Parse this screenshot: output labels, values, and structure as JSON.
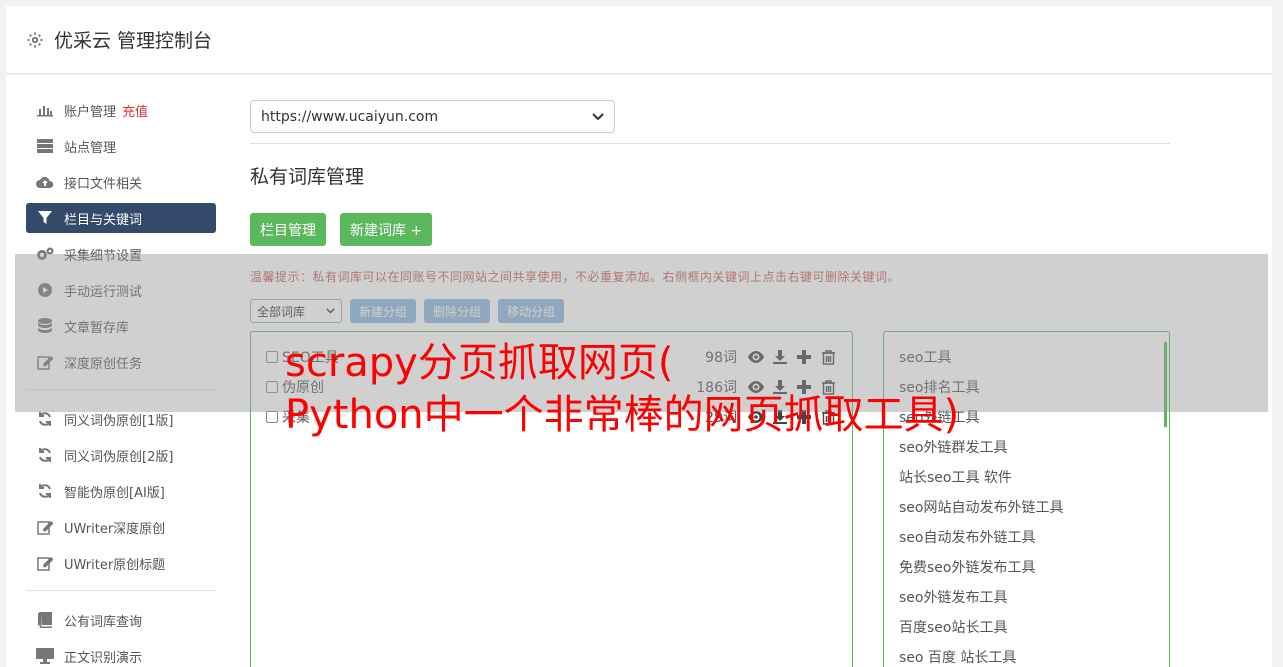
{
  "header": {
    "title": "优采云 管理控制台",
    "icon": "gear-icon"
  },
  "sidebar": {
    "group1": [
      {
        "label": "账户管理",
        "extra": "充值",
        "icon": "bar-chart-icon"
      },
      {
        "label": "站点管理",
        "icon": "server-icon"
      },
      {
        "label": "接口文件相关",
        "icon": "cloud-upload-icon"
      },
      {
        "label": "栏目与关键词",
        "icon": "filter-icon",
        "active": true
      },
      {
        "label": "采集细节设置",
        "icon": "gears-icon"
      },
      {
        "label": "手动运行测试",
        "icon": "play-icon"
      },
      {
        "label": "文章暂存库",
        "icon": "database-icon"
      },
      {
        "label": "深度原创任务",
        "icon": "edit-icon"
      }
    ],
    "group2": [
      {
        "label": "同义词伪原创[1版]",
        "icon": "refresh-icon"
      },
      {
        "label": "同义词伪原创[2版]",
        "icon": "refresh-icon"
      },
      {
        "label": "智能伪原创[AI版]",
        "icon": "refresh-icon"
      },
      {
        "label": "UWriter深度原创",
        "icon": "edit-icon"
      },
      {
        "label": "UWriter原创标题",
        "icon": "edit-icon"
      }
    ],
    "group3": [
      {
        "label": "公有词库查询",
        "icon": "book-icon"
      },
      {
        "label": "正文识别演示",
        "icon": "monitor-icon"
      }
    ]
  },
  "content": {
    "site_select": "https://www.ucaiyun.com",
    "section_title": "私有词库管理",
    "buttons": {
      "column_manage": "栏目管理",
      "new_library": "新建词库 +"
    },
    "tip": "温馨提示：私有词库可以在同账号不同网站之间共享使用，不必重复添加。右侧框内关键词上点击右键可删除关键词。",
    "filter_select": "全部词库",
    "tool_buttons": {
      "new_group": "新建分组",
      "delete_group": "删除分组",
      "move_group": "移动分组"
    },
    "libraries": [
      {
        "name": "SEO工具",
        "count": "98词"
      },
      {
        "name": "伪原创",
        "count": "186词"
      },
      {
        "name": "采集",
        "count": "29词"
      }
    ],
    "keywords": [
      "seo工具",
      "seo排名工具",
      "seo外链工具",
      "seo外链群发工具",
      "站长seo工具 软件",
      "seo网站自动发布外链工具",
      "seo自动发布外链工具",
      "免费seo外链发布工具",
      "seo外链发布工具",
      "百度seo站长工具",
      "seo 百度 站长工具"
    ]
  },
  "overlay": {
    "line1": "scrapy分页抓取网页(",
    "line2": "Python中一个非常棒的网页抓取工具)"
  },
  "colors": {
    "accent_green": "#5cb85c",
    "active_nav": "#334a6b",
    "tip_red": "#c45a5a",
    "overlay_text": "#ff0000"
  }
}
